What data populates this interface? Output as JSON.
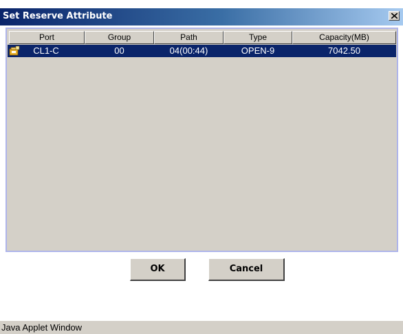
{
  "window": {
    "title": "Set Reserve Attribute",
    "close_glyph": "✕",
    "titlebar_colors": [
      "#0a246a",
      "#a6caf0"
    ]
  },
  "table": {
    "columns": [
      "Port",
      "Group",
      "Path",
      "Type",
      "Capacity(MB)"
    ],
    "rows": [
      {
        "icon": "volume-folder-icon",
        "port": "CL1-C",
        "group": "00",
        "path": "04(00:44)",
        "type": "OPEN-9",
        "capacity": "7042.50",
        "selected": true
      }
    ],
    "selection_color": "#0a246a"
  },
  "buttons": {
    "ok_label": "OK",
    "cancel_label": "Cancel"
  },
  "status_bar": {
    "text": "Java Applet Window"
  }
}
